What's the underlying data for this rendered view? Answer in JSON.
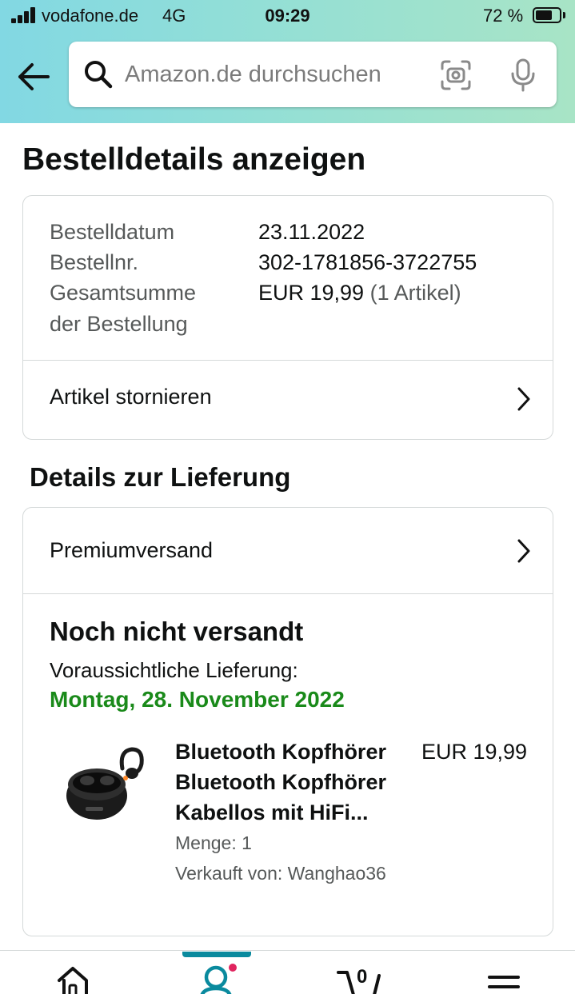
{
  "status_bar": {
    "carrier": "vodafone.de",
    "network": "4G",
    "time": "09:29",
    "battery_text": "72 %",
    "battery_level": 0.72
  },
  "search": {
    "placeholder": "Amazon.de durchsuchen"
  },
  "page": {
    "title": "Bestelldetails anzeigen"
  },
  "order_summary": {
    "rows": [
      {
        "label": "Bestelldatum",
        "value": "23.11.2022"
      },
      {
        "label": "Bestellnr.",
        "value": "302-1781856-3722755"
      }
    ],
    "total_label_line1": "Gesamtsumme",
    "total_label_line2": "der Bestellung",
    "total_value": "EUR 19,99",
    "total_items": "(1 Artikel)",
    "cancel_link": "Artikel stornieren"
  },
  "delivery": {
    "section_title": "Details zur Lieferung",
    "shipping_method": "Premiumversand",
    "status": "Noch nicht versandt",
    "expected_label": "Voraussichtliche Lieferung:",
    "expected_date": "Montag, 28. November 2022",
    "expected_date_color": "#1a8a1a"
  },
  "product": {
    "title_line1": "Bluetooth Kopfhörer",
    "title_line2": "Bluetooth Kopfhörer",
    "title_line3": "Kabellos mit HiFi...",
    "price": "EUR 19,99",
    "quantity": "Menge: 1",
    "seller": "Verkauft von: Wanghao36",
    "image_icon": "earbuds-image"
  },
  "bottom_nav": {
    "items": [
      "home-icon",
      "account-icon",
      "cart-icon",
      "menu-icon"
    ],
    "cart_count": "0",
    "active_item": "account-icon",
    "accent_color": "#0a8a9e"
  }
}
